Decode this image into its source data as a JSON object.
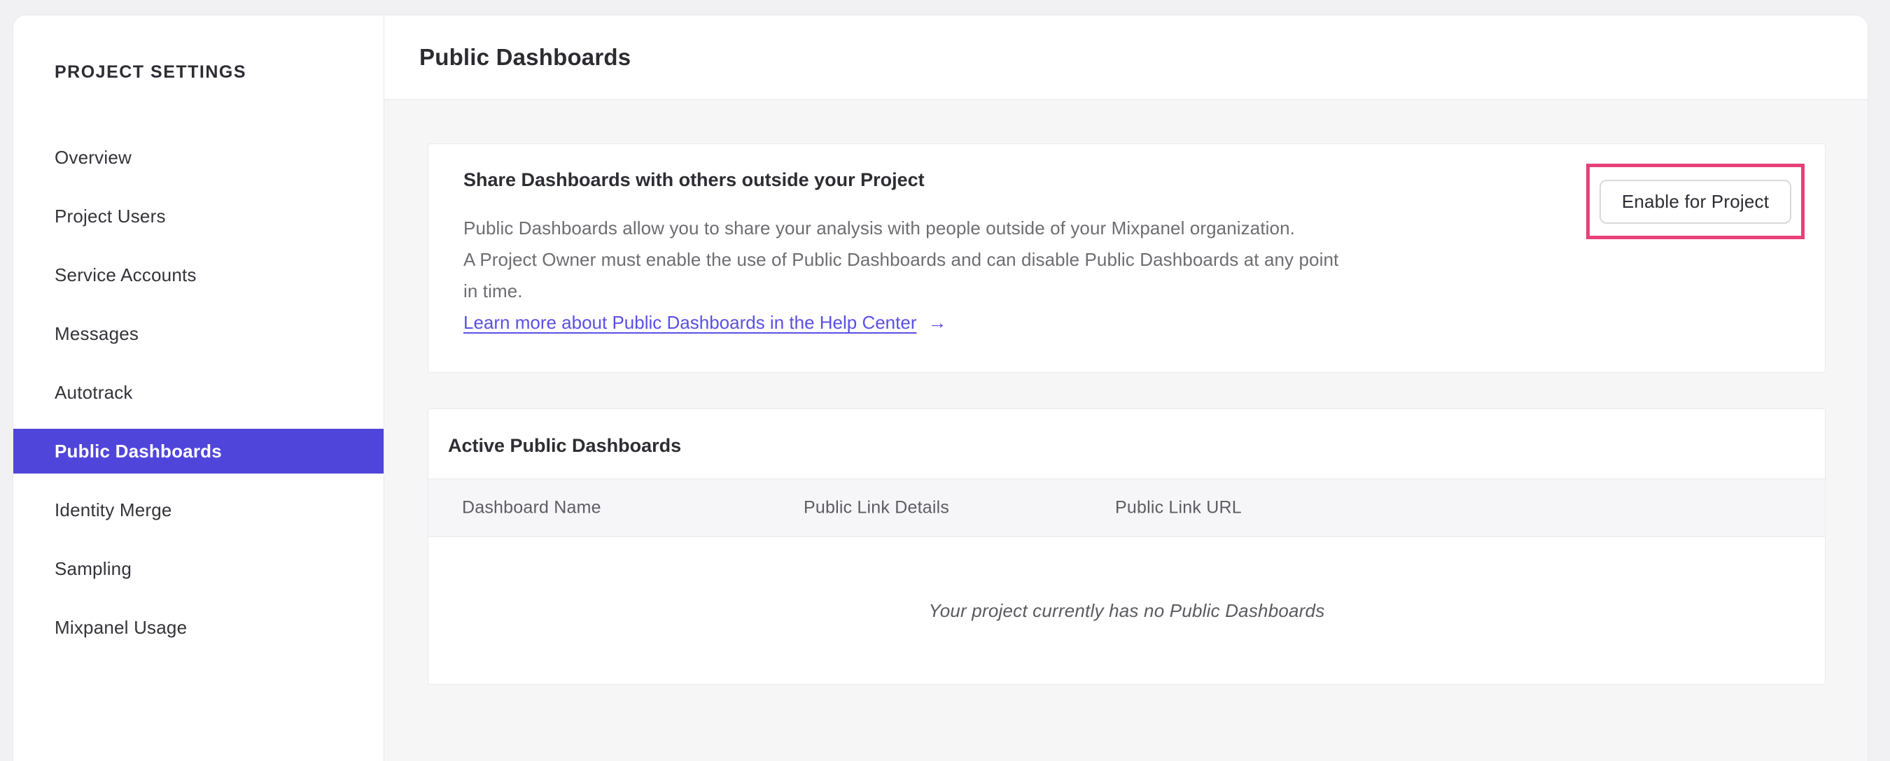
{
  "sidebar": {
    "title": "PROJECT SETTINGS",
    "items": [
      {
        "label": "Overview",
        "selected": false
      },
      {
        "label": "Project Users",
        "selected": false
      },
      {
        "label": "Service Accounts",
        "selected": false
      },
      {
        "label": "Messages",
        "selected": false
      },
      {
        "label": "Autotrack",
        "selected": false
      },
      {
        "label": "Public Dashboards",
        "selected": true
      },
      {
        "label": "Identity Merge",
        "selected": false
      },
      {
        "label": "Sampling",
        "selected": false
      },
      {
        "label": "Mixpanel Usage",
        "selected": false
      }
    ]
  },
  "header": {
    "title": "Public Dashboards"
  },
  "share_card": {
    "heading": "Share Dashboards with others outside your Project",
    "description_lines": [
      "Public Dashboards allow you to share your analysis with people outside of your Mixpanel organization.",
      "A Project Owner must enable the use of Public Dashboards and can disable Public Dashboards at any point",
      "in time."
    ],
    "link_label": "Learn more about Public Dashboards in the Help Center",
    "link_arrow": "→",
    "button_label": "Enable for Project"
  },
  "active_card": {
    "title": "Active Public Dashboards",
    "columns": [
      "Dashboard Name",
      "Public Link Details",
      "Public Link URL"
    ],
    "empty_message": "Your project currently has no Public Dashboards"
  },
  "colors": {
    "accent_purple": "#5045db",
    "link_purple": "#5b50e4",
    "highlight_pink": "#e8407a"
  }
}
